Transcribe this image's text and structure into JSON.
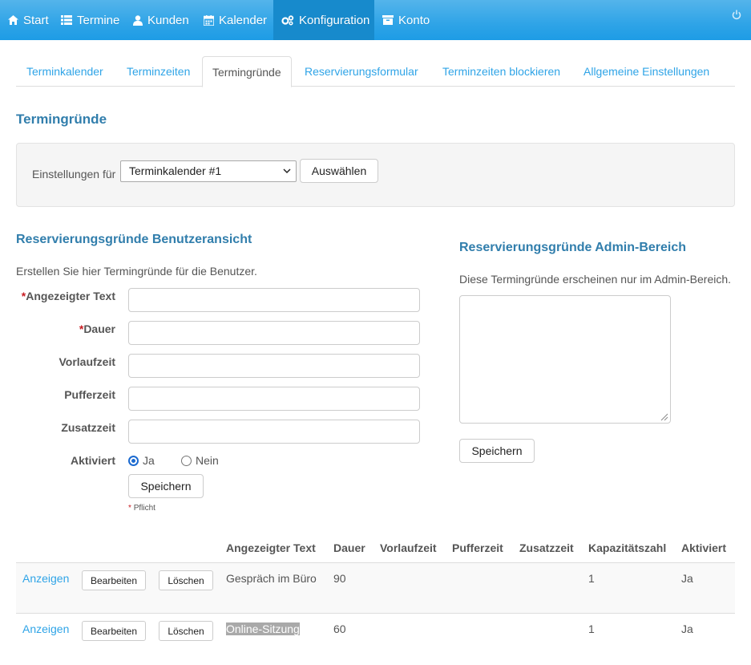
{
  "nav": {
    "items": [
      {
        "label": "Start",
        "icon": "home-icon"
      },
      {
        "label": "Termine",
        "icon": "list-icon"
      },
      {
        "label": "Kunden",
        "icon": "user-icon"
      },
      {
        "label": "Kalender",
        "icon": "calendar-icon"
      },
      {
        "label": "Konfiguration",
        "icon": "cogs-icon"
      },
      {
        "label": "Konto",
        "icon": "archive-icon"
      }
    ],
    "active": "Konfiguration",
    "power_icon": "power-icon"
  },
  "tabs": [
    "Terminkalender",
    "Terminzeiten",
    "Termingründe",
    "Reservierungsformular",
    "Terminzeiten blockieren",
    "Allgemeine Einstellungen"
  ],
  "page_title": "Termingründe",
  "settings": {
    "label": "Einstellungen für",
    "selected": "Terminkalender #1",
    "button": "Auswählen"
  },
  "user_section": {
    "title": "Reservierungsgründe Benutzeransicht",
    "description": "Erstellen Sie hier Termingründe für die Benutzer.",
    "fields": [
      {
        "label": "Angezeigter Text",
        "required": true,
        "value": ""
      },
      {
        "label": "Dauer",
        "required": true,
        "value": ""
      },
      {
        "label": "Vorlaufzeit",
        "required": false,
        "value": ""
      },
      {
        "label": "Pufferzeit",
        "required": false,
        "value": ""
      },
      {
        "label": "Zusatzzeit",
        "required": false,
        "value": ""
      }
    ],
    "active_label": "Aktiviert",
    "options": [
      "Ja",
      "Nein"
    ],
    "selected_option": "Ja",
    "save": "Speichern",
    "required_mark": "*",
    "required_note": "Pflicht"
  },
  "admin_section": {
    "title": "Reservierungsgründe Admin-Bereich",
    "description": "Diese Termingründe erscheinen nur im Admin-Bereich.",
    "value": "",
    "save": "Speichern"
  },
  "table": {
    "headers": [
      "Angezeigter Text",
      "Dauer",
      "Vorlaufzeit",
      "Pufferzeit",
      "Zusatzzeit",
      "Kapazitätszahl",
      "Aktiviert"
    ],
    "actions": {
      "view": "Anzeigen",
      "edit": "Bearbeiten",
      "delete": "Löschen"
    },
    "rows": [
      {
        "text": "Gespräch im Büro",
        "dauer": "90",
        "vorlaufzeit": "",
        "pufferzeit": "",
        "zusatzzeit": "",
        "kapazitaet": "1",
        "aktiviert": "Ja"
      },
      {
        "text": "Online-Sitzung",
        "dauer": "60",
        "vorlaufzeit": "",
        "pufferzeit": "",
        "zusatzzeit": "",
        "kapazitaet": "1",
        "aktiviert": "Ja"
      }
    ]
  },
  "colors": {
    "primary": "#2fa4e7",
    "heading": "#317eac",
    "nav_active": "#178acc",
    "required": "#c71c22"
  }
}
